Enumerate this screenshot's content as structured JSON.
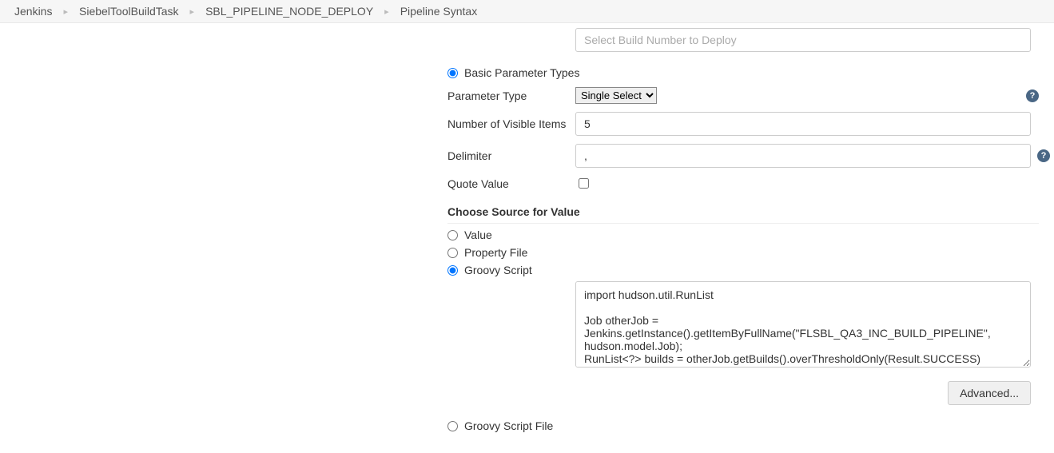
{
  "breadcrumb": {
    "items": [
      "Jenkins",
      "SiebelToolBuildTask",
      "SBL_PIPELINE_NODE_DEPLOY",
      "Pipeline Syntax"
    ]
  },
  "topField": {
    "placeholder": "Select Build Number to Deploy"
  },
  "paramSection": {
    "basic_label": "Basic Parameter Types",
    "param_type_label": "Parameter Type",
    "param_type_value": "Single Select",
    "visible_items_label": "Number of Visible Items",
    "visible_items_value": "5",
    "delimiter_label": "Delimiter",
    "delimiter_value": ",",
    "quote_label": "Quote Value"
  },
  "sourceSection": {
    "title": "Choose Source for Value",
    "value_label": "Value",
    "property_file_label": "Property File",
    "groovy_script_label": "Groovy Script",
    "groovy_script_file_label": "Groovy Script File",
    "script_text": "import hudson.util.RunList\n\nJob otherJob = Jenkins.getInstance().getItemByFullName(\"FLSBL_QA3_INC_BUILD_PIPELINE\", hudson.model.Job);\nRunList<?> builds = otherJob.getBuilds().overThresholdOnly(Result.SUCCESS)"
  },
  "advanced_label": "Advanced..."
}
